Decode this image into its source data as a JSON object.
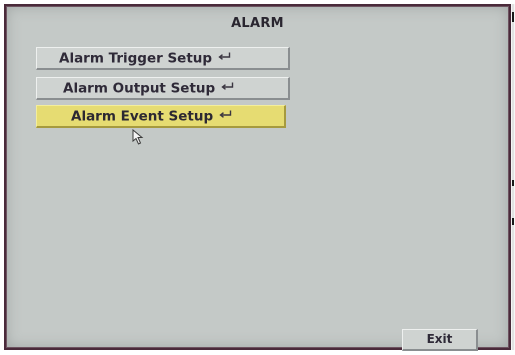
{
  "screen": {
    "title": "ALARM"
  },
  "menu": {
    "items": [
      {
        "label": "Alarm Trigger Setup",
        "icon": "enter-return-icon",
        "selected": false
      },
      {
        "label": "Alarm Output Setup",
        "icon": "enter-return-icon",
        "selected": false
      },
      {
        "label": "Alarm Event Setup",
        "icon": "enter-return-icon",
        "selected": true
      }
    ]
  },
  "footer": {
    "exit_label": "Exit"
  },
  "colors": {
    "background": "#c4c9c7",
    "button": "#cfd3d1",
    "selected_highlight": "#e6dc72",
    "text": "#2f2a38",
    "frame_border": "#4a2a3a"
  },
  "icons": {
    "pointer": "mouse-pointer-icon",
    "enter": "enter-return-icon"
  }
}
